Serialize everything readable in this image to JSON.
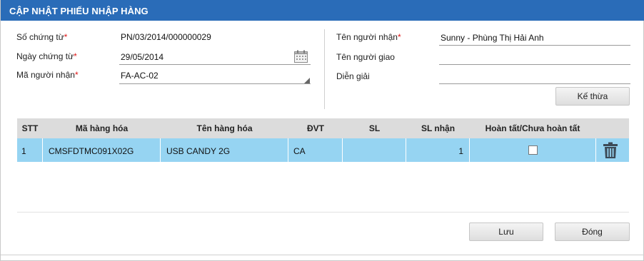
{
  "title": "CẬP NHẬT PHIẾU NHẬP HÀNG",
  "form_left": {
    "so_chung_tu": {
      "label": "Số chứng từ",
      "required_mark": "*",
      "value": "PN/03/2014/000000029"
    },
    "ngay_chung_tu": {
      "label": "Ngày chứng từ",
      "required_mark": "*",
      "value": "29/05/2014"
    },
    "ma_nguoi_nhan": {
      "label": "Mã người nhận",
      "required_mark": "*",
      "value": "FA-AC-02"
    }
  },
  "form_right": {
    "ten_nguoi_nhan": {
      "label": "Tên người nhận",
      "required_mark": "*",
      "value": "Sunny - Phùng Thị Hải Anh"
    },
    "ten_nguoi_giao": {
      "label": "Tên người giao",
      "value": ""
    },
    "dien_giai": {
      "label": "Diễn giải",
      "value": ""
    },
    "ke_thua_button": "Kế thừa"
  },
  "table": {
    "headers": [
      "STT",
      "Mã hàng hóa",
      "Tên hàng hóa",
      "ĐVT",
      "SL",
      "SL nhận",
      "Hoàn tất/Chưa hoàn tất"
    ],
    "rows": [
      {
        "stt": "1",
        "ma_hang_hoa": "CMSFDTMC091X02G",
        "ten_hang_hoa": "USB CANDY 2G",
        "dvt": "CA",
        "sl": "",
        "sl_nhan": "1",
        "hoan_tat": false
      }
    ]
  },
  "buttons": {
    "save": "Lưu",
    "close": "Đóng"
  },
  "icons": {
    "calendar": "calendar-icon",
    "dropdown": "dropdown-corner-icon",
    "delete": "trash-icon"
  },
  "colors": {
    "title_bar": "#2a6cb8",
    "selected_row": "#96d4f2",
    "required": "#e01616",
    "header": "#dcdcdc"
  }
}
